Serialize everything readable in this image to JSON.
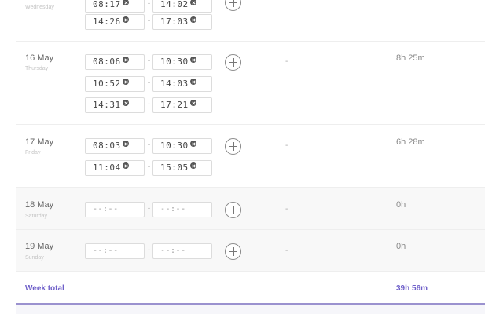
{
  "days": [
    {
      "date": "",
      "weekday": "Wednesday",
      "ranges": [
        {
          "start": "08:17",
          "end": "14:02"
        },
        {
          "start": "14:26",
          "end": "17:03"
        }
      ],
      "note": "-",
      "duration": ""
    },
    {
      "date": "16 May",
      "weekday": "Thursday",
      "ranges": [
        {
          "start": "08:06",
          "end": "10:30"
        },
        {
          "start": "10:52",
          "end": "14:03"
        },
        {
          "start": "14:31",
          "end": "17:21"
        }
      ],
      "note": "-",
      "duration": "8h 25m"
    },
    {
      "date": "17 May",
      "weekday": "Friday",
      "ranges": [
        {
          "start": "08:03",
          "end": "10:30"
        },
        {
          "start": "11:04",
          "end": "15:05"
        }
      ],
      "note": "-",
      "duration": "6h 28m"
    },
    {
      "date": "18 May",
      "weekday": "Saturday",
      "ranges": [
        {
          "start": "--:--",
          "end": "--:--"
        }
      ],
      "note": "-",
      "duration": "0h"
    },
    {
      "date": "19 May",
      "weekday": "Sunday",
      "ranges": [
        {
          "start": "--:--",
          "end": "--:--"
        }
      ],
      "note": "-",
      "duration": "0h"
    }
  ],
  "range_separator": "-",
  "week_total": {
    "label": "Week total",
    "value": "39h 56m"
  },
  "colors": {
    "accent": "#6e5fc9",
    "weekend_bg": "#f8f8f8"
  }
}
